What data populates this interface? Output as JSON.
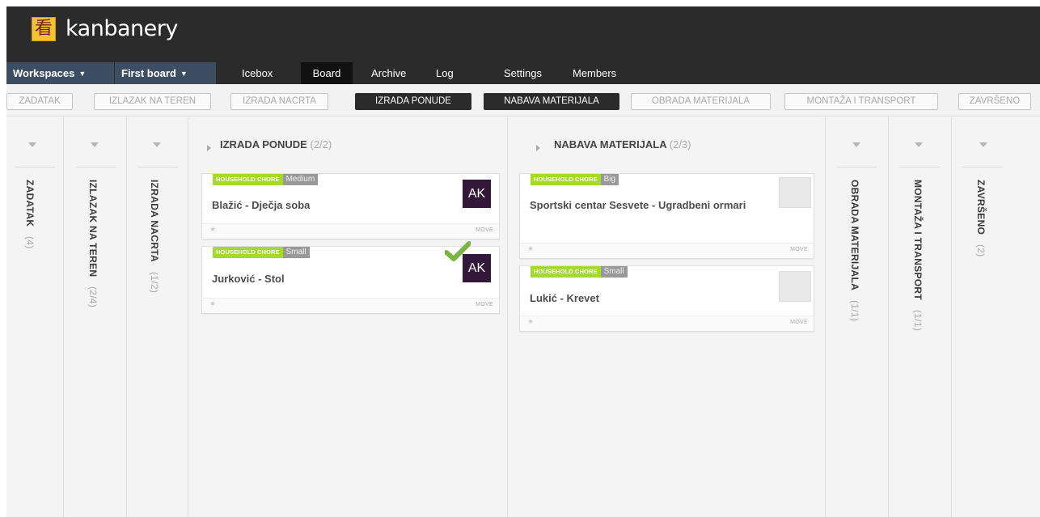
{
  "app": {
    "logo_glyph": "看",
    "name": "kanbanery"
  },
  "nav": {
    "workspaces": "Workspaces",
    "board_select": "First board",
    "tabs": [
      "Icebox",
      "Board",
      "Archive",
      "Log",
      "Settings",
      "Members"
    ],
    "active_tab": "Board"
  },
  "column_buttons": [
    "ZADATAK",
    "IZLAZAK NA TEREN",
    "IZRADA NACRTA",
    "IZRADA PONUDE",
    "NABAVA MATERIJALA",
    "OBRADA MATERIJALA",
    "MONTAŽA I TRANSPORT",
    "ZAVRŠENO"
  ],
  "collapsed_columns": {
    "zadatak": {
      "title": "ZADATAK",
      "count": "(4)"
    },
    "izlazak": {
      "title": "IZLAZAK NA TEREN",
      "count": "(2/4)"
    },
    "nacrta": {
      "title": "IZRADA NACRTA",
      "count": "(1/2)"
    },
    "obrada": {
      "title": "OBRADA MATERIJALA",
      "count": "(1/1)"
    },
    "montaza": {
      "title": "MONTAŽA I TRANSPORT",
      "count": "(1/1)"
    },
    "zavrseno": {
      "title": "ZAVRŠENO",
      "count": "(2)"
    }
  },
  "columns": {
    "ponude": {
      "title": "IZRADA PONUDE",
      "count": "(2/2)",
      "cards": [
        {
          "type": "HOUSEHOLD CHORE",
          "size": "Medium",
          "title": "Blažić - Dječja soba",
          "avatar": "AK",
          "move": "MOVE",
          "star": "★"
        },
        {
          "type": "HOUSEHOLD CHORE",
          "size": "Small",
          "title": "Jurković - Stol",
          "avatar": "AK",
          "move": "MOVE",
          "star": "★",
          "done": true
        }
      ]
    },
    "nabava": {
      "title": "NABAVA MATERIJALA",
      "count": "(2/3)",
      "cards": [
        {
          "type": "HOUSEHOLD CHORE",
          "size": "Big",
          "title": "Sportski centar Sesvete - Ugradbeni ormari",
          "avatar_placeholder": "image",
          "move": "MOVE",
          "star": "★"
        },
        {
          "type": "HOUSEHOLD CHORE",
          "size": "Small",
          "title": "Lukić - Krevet",
          "avatar_placeholder": "image",
          "move": "MOVE",
          "star": "★"
        }
      ]
    }
  },
  "colors": {
    "header_bg": "#2b2b2b",
    "dropdown_bg": "#3d4e63",
    "tag_green": "#a4d930",
    "avatar_bg": "#33183a",
    "check_green": "#7cb342"
  }
}
